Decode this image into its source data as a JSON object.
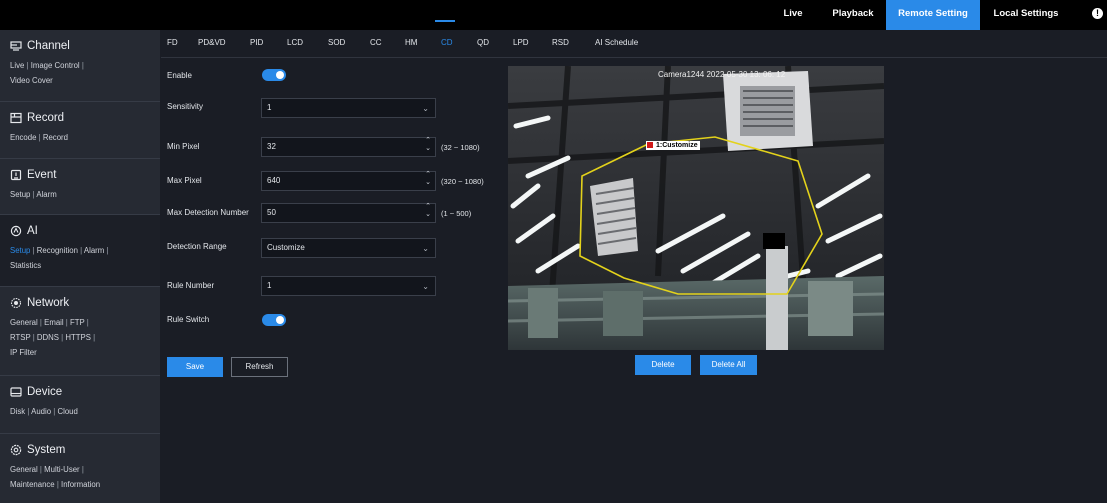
{
  "top_nav": {
    "tabs": [
      {
        "label": "Live",
        "active": false
      },
      {
        "label": "Playback",
        "active": false
      },
      {
        "label": "Remote Setting",
        "active": true
      },
      {
        "label": "Local Settings",
        "active": false
      }
    ],
    "info_glyph": "!"
  },
  "sidebar": {
    "sections": [
      {
        "title": "Channel",
        "icon": "channel-icon",
        "lines": [
          [
            "Live",
            "Image Control"
          ],
          [
            "Video Cover"
          ]
        ]
      },
      {
        "title": "Record",
        "icon": "record-icon",
        "lines": [
          [
            "Encode",
            "Record"
          ]
        ]
      },
      {
        "title": "Event",
        "icon": "event-icon",
        "lines": [
          [
            "Setup",
            "Alarm"
          ]
        ]
      },
      {
        "title": "AI",
        "icon": "ai-icon",
        "lines": [
          [
            "Setup",
            "Recognition",
            "Alarm"
          ],
          [
            "Statistics"
          ]
        ]
      },
      {
        "title": "Network",
        "icon": "network-icon",
        "lines": [
          [
            "General",
            "Email",
            "FTP"
          ],
          [
            "RTSP",
            "DDNS",
            "HTTPS"
          ],
          [
            "IP Filter"
          ]
        ]
      },
      {
        "title": "Device",
        "icon": "device-icon",
        "lines": [
          [
            "Disk",
            "Audio",
            "Cloud"
          ]
        ]
      },
      {
        "title": "System",
        "icon": "system-icon",
        "lines": [
          [
            "General",
            "Multi-User"
          ],
          [
            "Maintenance",
            "Information"
          ]
        ]
      }
    ],
    "active_section": "AI",
    "active_link": "Setup"
  },
  "subtabs": [
    "FD",
    "PD&VD",
    "PID",
    "LCD",
    "SOD",
    "CC",
    "HM",
    "CD",
    "QD",
    "LPD",
    "RSD",
    "AI Schedule"
  ],
  "active_subtab": "CD",
  "form": {
    "enable_label": "Enable",
    "enable_on": true,
    "sensitivity_label": "Sensitivity",
    "sensitivity_value": "1",
    "min_pixel_label": "Min Pixel",
    "min_pixel_value": "32",
    "min_pixel_range": "(32 ~ 1080)",
    "max_pixel_label": "Max Pixel",
    "max_pixel_value": "640",
    "max_pixel_range": "(320 ~ 1080)",
    "max_detection_label": "Max Detection Number",
    "max_detection_value": "50",
    "max_detection_range": "(1 ~ 500)",
    "detection_range_label": "Detection Range",
    "detection_range_value": "Customize",
    "rule_number_label": "Rule Number",
    "rule_number_value": "1",
    "rule_switch_label": "Rule Switch",
    "rule_switch_on": true,
    "save_label": "Save",
    "refresh_label": "Refresh"
  },
  "camera": {
    "overlay_text": "Camera1244  2022-05-30  13: 06: 12",
    "region_label": "1:Customize",
    "delete_label": "Delete",
    "delete_all_label": "Delete All"
  },
  "colors": {
    "accent": "#2a8ae8",
    "region_outline": "#e3d21b",
    "region_marker": "#d01a1a"
  }
}
